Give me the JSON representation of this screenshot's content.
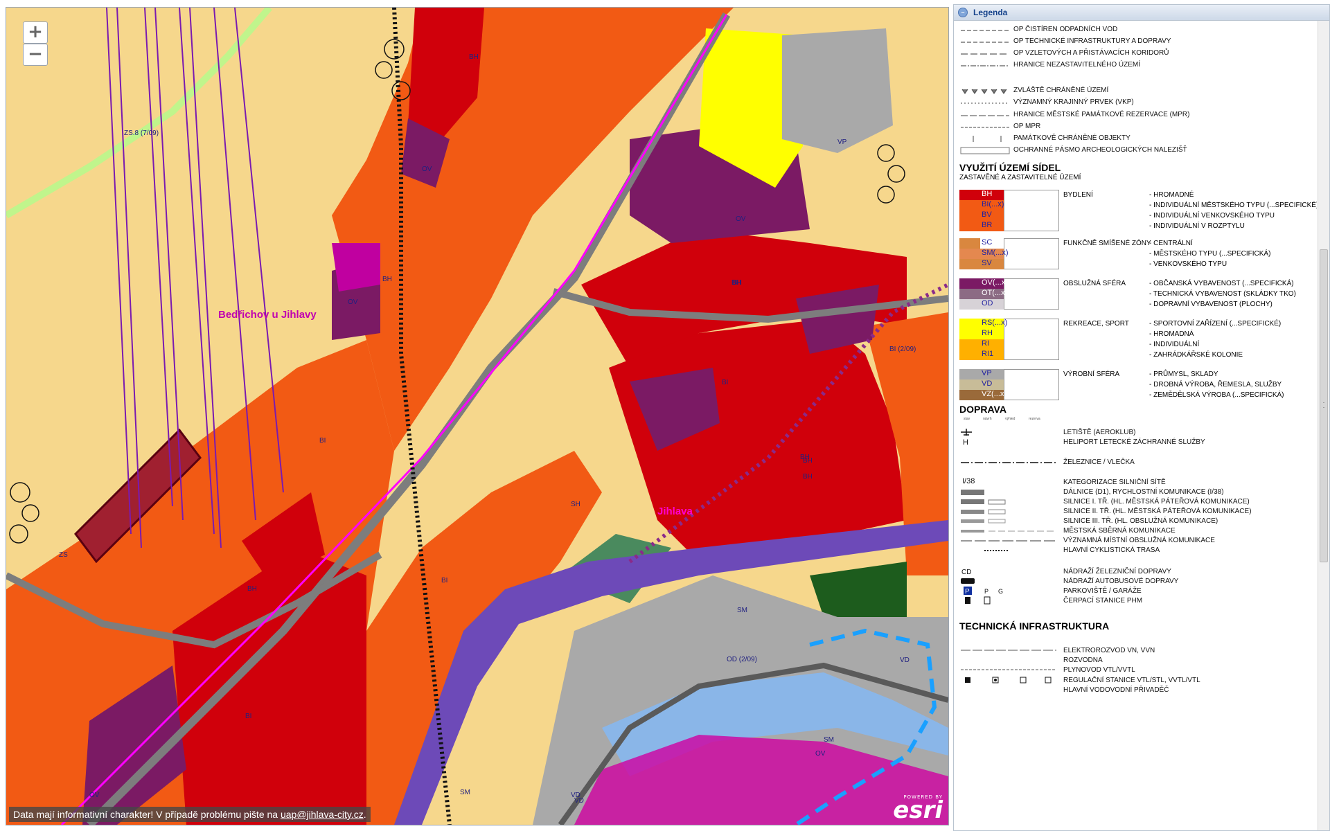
{
  "map": {
    "zoom_in_label": "+",
    "zoom_out_label": "−",
    "attribution_text": "Data mají informativní charakter! V případě problému pište na ",
    "attribution_email": "uap@jihlava-city.cz",
    "attribution_end": ".",
    "logo_powered": "POWERED BY",
    "logo_name": "esri",
    "place_labels": [
      "Bedřichov u Jihlavy",
      "Jihlava"
    ],
    "zone_labels": [
      "BH",
      "OV",
      "ZS.8 (7/09)",
      "BH",
      "OV",
      "BI",
      "OV",
      "BH",
      "ZS",
      "BH",
      "BI",
      "SH",
      "BI",
      "BH",
      "VP",
      "BH",
      "BI (2/09)",
      "BH",
      "OV",
      "BI",
      "SM",
      "BH",
      "SM",
      "VD",
      "OD (2/09)",
      "VD",
      "OV",
      "SM",
      "VD"
    ],
    "colors": {
      "bh": "#d0000b",
      "bi": "#f25a14",
      "ov": "#7b1a64",
      "base": "#f6d78c"
    }
  },
  "legend": {
    "title": "Legenda",
    "top_lines": [
      "OP ČISTÍREN ODPADNÍCH VOD",
      "OP TECHNICKÉ INFRASTRUKTURY A DOPRAVY",
      "OP VZLETOVÝCH A PŘISTÁVACÍCH KORIDORŮ",
      "HRANICE NEZASTAVITELNÉHO ÚZEMÍ"
    ],
    "prot_lines": [
      "ZVLÁŠTĚ CHRÁNĚNÉ ÚZEMÍ",
      "VÝZNAMNÝ KRAJINNÝ PRVEK (VKP)",
      "HRANICE MĚSTSKÉ PAMÁTKOVÉ REZERVACE (MPR)",
      "OP MPR",
      "PAMÁTKOVĚ CHRÁNĚNÉ OBJEKTY",
      "OCHRANNÉ PÁSMO ARCHEOLOGICKÝCH NALEZIŠŤ"
    ],
    "uzemi_title": "VYUŽITÍ ÚZEMÍ SÍDEL",
    "uzemi_sub": "ZASTAVĚNÉ A ZASTAVITELNÉ ÚZEMÍ",
    "groups": [
      {
        "cat": "BYDLENÍ",
        "items": [
          {
            "code": "BH",
            "desc": "- HROMADNÉ",
            "color": "#d0000b"
          },
          {
            "code": "BI(...x)",
            "desc": "- INDIVIDUÁLNÍ MĚSTSKÉHO TYPU (...SPECIFICKÉ)",
            "color": "#f25a14"
          },
          {
            "code": "BV",
            "desc": "- INDIVIDUÁLNÍ VENKOVSKÉHO TYPU",
            "color": "#f25a14"
          },
          {
            "code": "BR",
            "desc": "- INDIVIDUÁLNÍ V ROZPTYLU",
            "color": "#f25a14"
          }
        ]
      },
      {
        "cat": "FUNKČNĚ SMÍŠENÉ ZÓNY",
        "items": [
          {
            "code": "SC",
            "desc": "- CENTRÁLNÍ",
            "color": "#d9873f"
          },
          {
            "code": "SM(...x)",
            "desc": "- MĚSTSKÉHO TYPU (...SPECIFICKÁ)",
            "color": "#e4884f"
          },
          {
            "code": "SV",
            "desc": "- VENKOVSKÉHO TYPU",
            "color": "#d9873f"
          }
        ]
      },
      {
        "cat": "OBSLUŽNÁ SFÉRA",
        "items": [
          {
            "code": "OV(...x)",
            "desc": "- OBČANSKÁ VYBAVENOST (...SPECIFICKÁ)",
            "color": "#7b1a64"
          },
          {
            "code": "OT(...x)",
            "desc": "- TECHNICKÁ VYBAVENOST (SKLÁDKY TKO)",
            "color": "#8c6b84"
          },
          {
            "code": "OD",
            "desc": "- DOPRAVNÍ VYBAVENOST (PLOCHY)",
            "color": "#d7d2d7"
          }
        ]
      },
      {
        "cat": "REKREACE, SPORT",
        "items": [
          {
            "code": "RS(...x)",
            "desc": "- SPORTOVNÍ ZAŘÍZENÍ (...SPECIFICKÉ)",
            "color": "#ffff00"
          },
          {
            "code": "RH",
            "desc": "- HROMADNÁ",
            "color": "#ffff00"
          },
          {
            "code": "RI",
            "desc": "- INDIVIDUÁLNÍ",
            "color": "#ffb000"
          },
          {
            "code": "RI1",
            "desc": "- ZAHRÁDKÁŘSKÉ KOLONIE",
            "color": "#ffb000"
          }
        ]
      },
      {
        "cat": "VÝROBNÍ SFÉRA",
        "items": [
          {
            "code": "VP",
            "desc": "- PRŮMYSL, SKLADY",
            "color": "#a9a9a9"
          },
          {
            "code": "VD",
            "desc": "- DROBNÁ VÝROBA, ŘEMESLA, SLUŽBY",
            "color": "#c8bc98"
          },
          {
            "code": "VZ(...x)",
            "desc": "- ZEMĚDĚLSKÁ VÝROBA (...SPECIFICKÁ)",
            "color": "#9a6a3a"
          }
        ]
      }
    ],
    "doprava_title": "DOPRAVA",
    "doprava_lines": [
      "LETIŠTĚ (AEROKLUB)",
      "HELIPORT LETECKÉ ZÁCHRANNÉ SLUŽBY",
      "ŽELEZNICE / VLEČKA",
      "KATEGORIZACE SILNIČNÍ SÍTĚ",
      "DÁLNICE (D1), RYCHLOSTNÍ KOMUNIKACE (I/38)",
      "SILNICE I. TŘ. (HL. MĚSTSKÁ PÁTEŘOVÁ KOMUNIKACE)",
      "SILNICE II. TŘ. (HL. MĚSTSKÁ PÁTEŘOVÁ KOMUNIKACE)",
      "SILNICE III. TŘ. (HL. OBSLUŽNÁ KOMUNIKACE)",
      "MĚSTSKÁ SBĚRNÁ KOMUNIKACE",
      "VÝZNAMNÁ MÍSTNÍ OBSLUŽNÁ KOMUNIKACE",
      "HLAVNÍ CYKLISTICKÁ TRASA",
      "NÁDRAŽÍ ŽELEZNIČNÍ DOPRAVY",
      "NÁDRAŽÍ AUTOBUSOVÉ DOPRAVY",
      "PARKOVIŠTĚ / GARÁŽE",
      "ČERPACÍ STANICE PHM"
    ],
    "doprava_code": "I/38",
    "tech_title": "TECHNICKÁ INFRASTRUKTURA",
    "tech_lines": [
      "ELEKTROROZVOD VN, VVN",
      "ROZVODNA",
      "PLYNOVOD VTL/VVTL",
      "REGULAČNÍ STANICE VTL/STL, VVTL/VTL",
      "HLAVNÍ VODOVODNÍ PŘIVADĚČ"
    ],
    "col_headers": [
      "stav",
      "návrh",
      "výhled",
      "rezerva"
    ]
  }
}
